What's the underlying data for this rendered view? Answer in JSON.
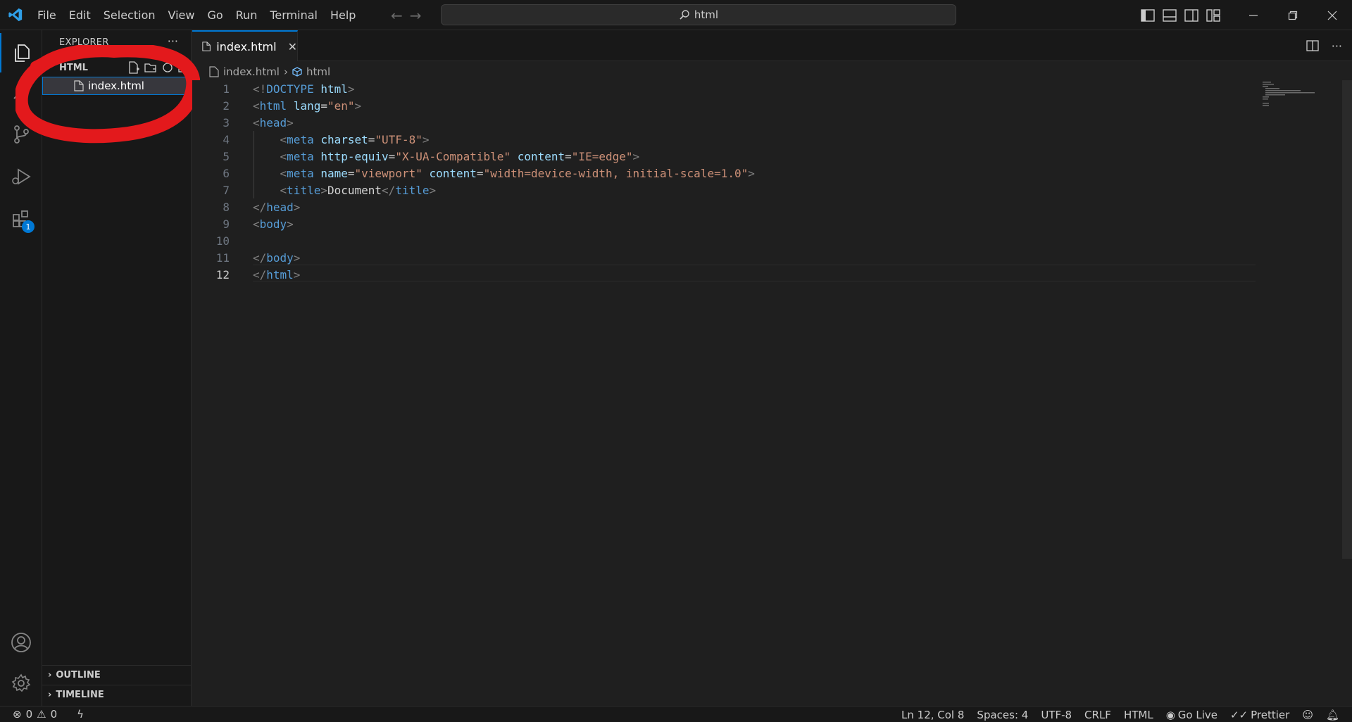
{
  "menu": [
    "File",
    "Edit",
    "Selection",
    "View",
    "Go",
    "Run",
    "Terminal",
    "Help"
  ],
  "command_center": {
    "text": "html",
    "icon": "search-icon"
  },
  "activity_bar": {
    "items": [
      "explorer-icon",
      "search-icon",
      "source-control-icon",
      "run-debug-icon",
      "extensions-icon"
    ],
    "extensions_badge": "1",
    "bottom": [
      "account-icon",
      "settings-gear-icon"
    ]
  },
  "sidebar": {
    "header": "EXPLORER",
    "more": "···",
    "folder_name": "HTML",
    "files": [
      {
        "name": "index.html",
        "selected": true
      }
    ],
    "sections": [
      "OUTLINE",
      "TIMELINE"
    ]
  },
  "tab": {
    "label": "index.html",
    "close": "✕"
  },
  "breadcrumb": {
    "file": "index.html",
    "symbol": "html"
  },
  "editor": {
    "active_line": 12,
    "lines": [
      {
        "n": "1",
        "tokens": [
          [
            "punct",
            "<!"
          ],
          [
            "tag",
            "DOCTYPE"
          ],
          [
            "text",
            " "
          ],
          [
            "attr",
            "html"
          ],
          [
            "punct",
            ">"
          ]
        ]
      },
      {
        "n": "2",
        "tokens": [
          [
            "punct",
            "<"
          ],
          [
            "tag",
            "html"
          ],
          [
            "text",
            " "
          ],
          [
            "attr",
            "lang"
          ],
          [
            "text",
            "="
          ],
          [
            "str",
            "\"en\""
          ],
          [
            "punct",
            ">"
          ]
        ]
      },
      {
        "n": "3",
        "tokens": [
          [
            "punct",
            "<"
          ],
          [
            "tag",
            "head"
          ],
          [
            "punct",
            ">"
          ]
        ]
      },
      {
        "n": "4",
        "tokens": [
          [
            "text",
            "    "
          ],
          [
            "punct",
            "<"
          ],
          [
            "tag",
            "meta"
          ],
          [
            "text",
            " "
          ],
          [
            "attr",
            "charset"
          ],
          [
            "text",
            "="
          ],
          [
            "str",
            "\"UTF-8\""
          ],
          [
            "punct",
            ">"
          ]
        ]
      },
      {
        "n": "5",
        "tokens": [
          [
            "text",
            "    "
          ],
          [
            "punct",
            "<"
          ],
          [
            "tag",
            "meta"
          ],
          [
            "text",
            " "
          ],
          [
            "attr",
            "http-equiv"
          ],
          [
            "text",
            "="
          ],
          [
            "str",
            "\"X-UA-Compatible\""
          ],
          [
            "text",
            " "
          ],
          [
            "attr",
            "content"
          ],
          [
            "text",
            "="
          ],
          [
            "str",
            "\"IE=edge\""
          ],
          [
            "punct",
            ">"
          ]
        ]
      },
      {
        "n": "6",
        "tokens": [
          [
            "text",
            "    "
          ],
          [
            "punct",
            "<"
          ],
          [
            "tag",
            "meta"
          ],
          [
            "text",
            " "
          ],
          [
            "attr",
            "name"
          ],
          [
            "text",
            "="
          ],
          [
            "str",
            "\"viewport\""
          ],
          [
            "text",
            " "
          ],
          [
            "attr",
            "content"
          ],
          [
            "text",
            "="
          ],
          [
            "str",
            "\"width=device-width, initial-scale=1.0\""
          ],
          [
            "punct",
            ">"
          ]
        ]
      },
      {
        "n": "7",
        "tokens": [
          [
            "text",
            "    "
          ],
          [
            "punct",
            "<"
          ],
          [
            "tag",
            "title"
          ],
          [
            "punct",
            ">"
          ],
          [
            "text",
            "Document"
          ],
          [
            "punct",
            "</"
          ],
          [
            "tag",
            "title"
          ],
          [
            "punct",
            ">"
          ]
        ]
      },
      {
        "n": "8",
        "tokens": [
          [
            "punct",
            "</"
          ],
          [
            "tag",
            "head"
          ],
          [
            "punct",
            ">"
          ]
        ]
      },
      {
        "n": "9",
        "tokens": [
          [
            "punct",
            "<"
          ],
          [
            "tag",
            "body"
          ],
          [
            "punct",
            ">"
          ]
        ]
      },
      {
        "n": "10",
        "tokens": []
      },
      {
        "n": "11",
        "tokens": [
          [
            "punct",
            "</"
          ],
          [
            "tag",
            "body"
          ],
          [
            "punct",
            ">"
          ]
        ]
      },
      {
        "n": "12",
        "tokens": [
          [
            "punct",
            "</"
          ],
          [
            "tag",
            "html"
          ],
          [
            "punct",
            ">"
          ]
        ]
      }
    ]
  },
  "status": {
    "errors": "0",
    "warnings": "0",
    "position": "Ln 12, Col 8",
    "spaces": "Spaces: 4",
    "encoding": "UTF-8",
    "eol": "CRLF",
    "language": "HTML",
    "go_live": "Go Live",
    "prettier": "Prettier"
  },
  "colors": {
    "accent": "#0078d4",
    "annotation": "#e3191c",
    "tag": "#569cd6",
    "attr": "#9cdcfe",
    "string": "#ce9178"
  }
}
